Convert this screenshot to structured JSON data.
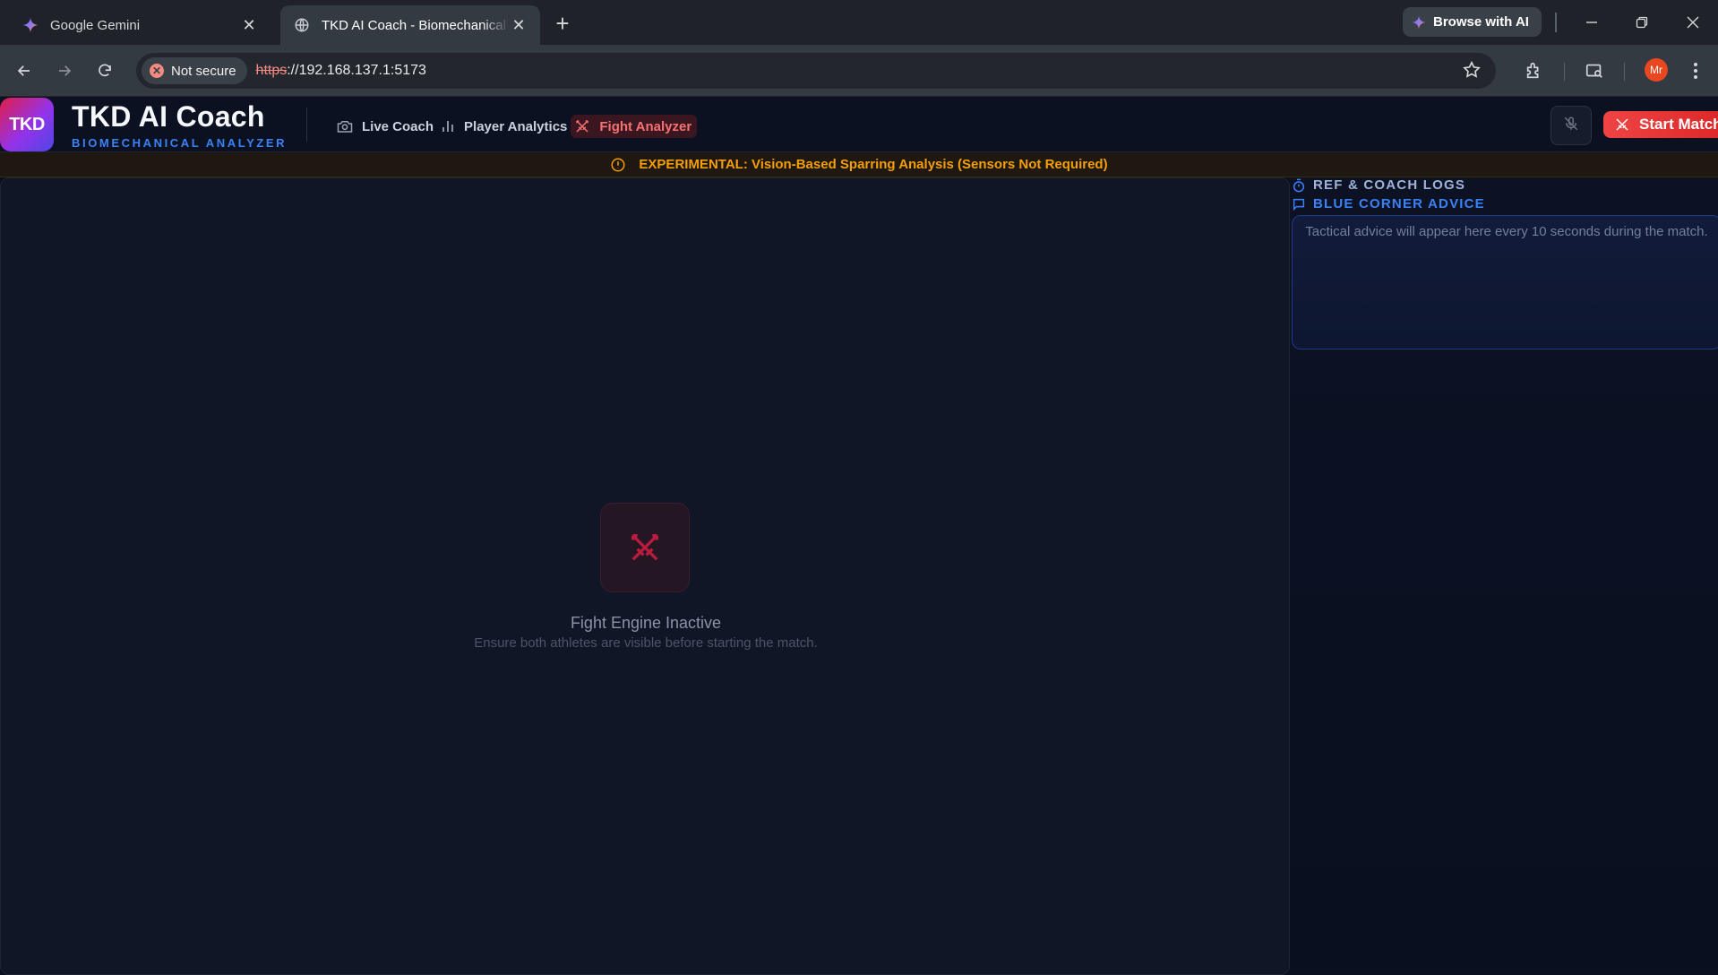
{
  "browser": {
    "tabs": [
      {
        "title": "Google Gemini",
        "active": false,
        "icon": "gemini-spark-icon"
      },
      {
        "title": "TKD AI Coach - Biomechanical Analyzer",
        "active": true,
        "icon": "globe-icon"
      }
    ],
    "browse_ai_label": "Browse with AI",
    "security_label": "Not secure",
    "url_scheme": "https",
    "url_rest": "://192.168.137.1:5173",
    "profile_initials": "Mr"
  },
  "app": {
    "logo_text": "TKD",
    "title": "TKD AI Coach",
    "subtitle": "BIOMECHANICAL ANALYZER",
    "nav": [
      {
        "label": "Live Coach",
        "icon": "camera-icon",
        "active": false
      },
      {
        "label": "Player Analytics",
        "icon": "bar-chart-icon",
        "active": false
      },
      {
        "label": "Fight Analyzer",
        "icon": "crossed-swords-icon",
        "active": true
      }
    ],
    "start_label": "Start Match",
    "banner_text": "EXPERIMENTAL: Vision-Based Sparring Analysis (Sensors Not Required)",
    "engine": {
      "title": "Fight Engine Inactive",
      "subtitle": "Ensure both athletes are visible before starting the match."
    },
    "side": {
      "logs_title": "REF & COACH LOGS",
      "advice_title": "BLUE CORNER ADVICE",
      "advice_placeholder": "Tactical advice will appear here every 10 seconds during the match."
    }
  },
  "colors": {
    "accent_red": "#ef4444",
    "accent_blue": "#3b82f6",
    "warning": "#f59e0b",
    "background": "#0a0f1e"
  }
}
